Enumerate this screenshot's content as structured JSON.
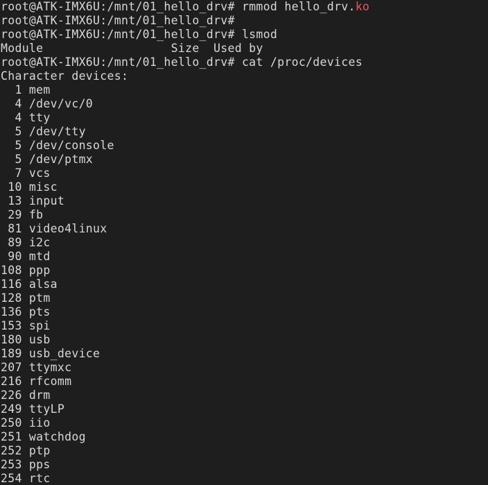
{
  "terminal": {
    "window_title": "Terminal",
    "background_color": "#1e1e1e",
    "foreground_color": "#d8d8d8",
    "accent_red": "#e05c5c",
    "prompt": "root@ATK-IMX6U:/mnt/01_hello_drv#",
    "user": "root",
    "host": "ATK-IMX6U",
    "cwd": "/mnt/01_hello_drv",
    "columns": 70,
    "rows": 35,
    "lines": [
      {
        "id": "line-1",
        "segments": [
          {
            "text": "root@ATK-IMX6U:/mnt/01_hello_drv# rmmod hello_drv.",
            "color": "default"
          },
          {
            "text": "ko",
            "color": "red"
          }
        ]
      },
      {
        "id": "line-2",
        "segments": [
          {
            "text": "root@ATK-IMX6U:/mnt/01_hello_drv# ",
            "color": "default"
          }
        ]
      },
      {
        "id": "line-3",
        "segments": [
          {
            "text": "root@ATK-IMX6U:/mnt/01_hello_drv# lsmod",
            "color": "default"
          }
        ]
      },
      {
        "id": "line-4",
        "segments": [
          {
            "text": "Module                  Size  Used by",
            "color": "default"
          }
        ]
      },
      {
        "id": "line-5",
        "segments": [
          {
            "text": "root@ATK-IMX6U:/mnt/01_hello_drv# cat /proc/devices",
            "color": "default"
          }
        ]
      },
      {
        "id": "line-6",
        "segments": [
          {
            "text": "Character devices:",
            "color": "default"
          }
        ]
      },
      {
        "id": "line-7",
        "segments": [
          {
            "text": "  1 mem",
            "color": "default"
          }
        ]
      },
      {
        "id": "line-8",
        "segments": [
          {
            "text": "  4 /dev/vc/0",
            "color": "default"
          }
        ]
      },
      {
        "id": "line-9",
        "segments": [
          {
            "text": "  4 tty",
            "color": "default"
          }
        ]
      },
      {
        "id": "line-10",
        "segments": [
          {
            "text": "  5 /dev/tty",
            "color": "default"
          }
        ]
      },
      {
        "id": "line-11",
        "segments": [
          {
            "text": "  5 /dev/console",
            "color": "default"
          }
        ]
      },
      {
        "id": "line-12",
        "segments": [
          {
            "text": "  5 /dev/ptmx",
            "color": "default"
          }
        ]
      },
      {
        "id": "line-13",
        "segments": [
          {
            "text": "  7 vcs",
            "color": "default"
          }
        ]
      },
      {
        "id": "line-14",
        "segments": [
          {
            "text": " 10 misc",
            "color": "default"
          }
        ]
      },
      {
        "id": "line-15",
        "segments": [
          {
            "text": " 13 input",
            "color": "default"
          }
        ]
      },
      {
        "id": "line-16",
        "segments": [
          {
            "text": " 29 fb",
            "color": "default"
          }
        ]
      },
      {
        "id": "line-17",
        "segments": [
          {
            "text": " 81 video4linux",
            "color": "default"
          }
        ]
      },
      {
        "id": "line-18",
        "segments": [
          {
            "text": " 89 i2c",
            "color": "default"
          }
        ]
      },
      {
        "id": "line-19",
        "segments": [
          {
            "text": " 90 mtd",
            "color": "default"
          }
        ]
      },
      {
        "id": "line-20",
        "segments": [
          {
            "text": "108 ppp",
            "color": "default"
          }
        ]
      },
      {
        "id": "line-21",
        "segments": [
          {
            "text": "116 alsa",
            "color": "default"
          }
        ]
      },
      {
        "id": "line-22",
        "segments": [
          {
            "text": "128 ptm",
            "color": "default"
          }
        ]
      },
      {
        "id": "line-23",
        "segments": [
          {
            "text": "136 pts",
            "color": "default"
          }
        ]
      },
      {
        "id": "line-24",
        "segments": [
          {
            "text": "153 spi",
            "color": "default"
          }
        ]
      },
      {
        "id": "line-25",
        "segments": [
          {
            "text": "180 usb",
            "color": "default"
          }
        ]
      },
      {
        "id": "line-26",
        "segments": [
          {
            "text": "189 usb_device",
            "color": "default"
          }
        ]
      },
      {
        "id": "line-27",
        "segments": [
          {
            "text": "207 ttymxc",
            "color": "default"
          }
        ]
      },
      {
        "id": "line-28",
        "segments": [
          {
            "text": "216 rfcomm",
            "color": "default"
          }
        ]
      },
      {
        "id": "line-29",
        "segments": [
          {
            "text": "226 drm",
            "color": "default"
          }
        ]
      },
      {
        "id": "line-30",
        "segments": [
          {
            "text": "249 ttyLP",
            "color": "default"
          }
        ]
      },
      {
        "id": "line-31",
        "segments": [
          {
            "text": "250 iio",
            "color": "default"
          }
        ]
      },
      {
        "id": "line-32",
        "segments": [
          {
            "text": "251 watchdog",
            "color": "default"
          }
        ]
      },
      {
        "id": "line-33",
        "segments": [
          {
            "text": "252 ptp",
            "color": "default"
          }
        ]
      },
      {
        "id": "line-34",
        "segments": [
          {
            "text": "253 pps",
            "color": "default"
          }
        ]
      },
      {
        "id": "line-35",
        "segments": [
          {
            "text": "254 rtc",
            "color": "default"
          }
        ]
      }
    ],
    "commands": [
      {
        "text": "rmmod hello_drv.ko"
      },
      {
        "text": "lsmod"
      },
      {
        "text": "cat /proc/devices"
      }
    ],
    "lsmod_headers": [
      "Module",
      "Size",
      "Used by"
    ],
    "character_devices_heading": "Character devices:",
    "character_devices": [
      {
        "major": "1",
        "name": "mem"
      },
      {
        "major": "4",
        "name": "/dev/vc/0"
      },
      {
        "major": "4",
        "name": "tty"
      },
      {
        "major": "5",
        "name": "/dev/tty"
      },
      {
        "major": "5",
        "name": "/dev/console"
      },
      {
        "major": "5",
        "name": "/dev/ptmx"
      },
      {
        "major": "7",
        "name": "vcs"
      },
      {
        "major": "10",
        "name": "misc"
      },
      {
        "major": "13",
        "name": "input"
      },
      {
        "major": "29",
        "name": "fb"
      },
      {
        "major": "81",
        "name": "video4linux"
      },
      {
        "major": "89",
        "name": "i2c"
      },
      {
        "major": "90",
        "name": "mtd"
      },
      {
        "major": "108",
        "name": "ppp"
      },
      {
        "major": "116",
        "name": "alsa"
      },
      {
        "major": "128",
        "name": "ptm"
      },
      {
        "major": "136",
        "name": "pts"
      },
      {
        "major": "153",
        "name": "spi"
      },
      {
        "major": "180",
        "name": "usb"
      },
      {
        "major": "189",
        "name": "usb_device"
      },
      {
        "major": "207",
        "name": "ttymxc"
      },
      {
        "major": "216",
        "name": "rfcomm"
      },
      {
        "major": "226",
        "name": "drm"
      },
      {
        "major": "249",
        "name": "ttyLP"
      },
      {
        "major": "250",
        "name": "iio"
      },
      {
        "major": "251",
        "name": "watchdog"
      },
      {
        "major": "252",
        "name": "ptp"
      },
      {
        "major": "253",
        "name": "pps"
      },
      {
        "major": "254",
        "name": "rtc"
      }
    ]
  }
}
